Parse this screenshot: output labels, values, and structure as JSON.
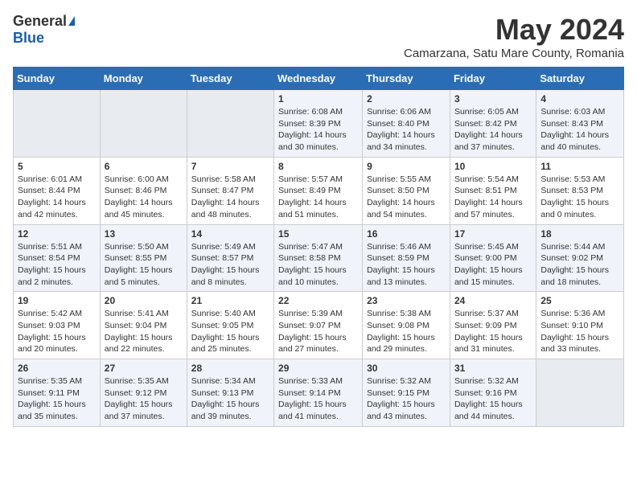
{
  "header": {
    "logo_general": "General",
    "logo_blue": "Blue",
    "month_title": "May 2024",
    "location": "Camarzana, Satu Mare County, Romania"
  },
  "weekdays": [
    "Sunday",
    "Monday",
    "Tuesday",
    "Wednesday",
    "Thursday",
    "Friday",
    "Saturday"
  ],
  "weeks": [
    [
      {
        "day": "",
        "info": ""
      },
      {
        "day": "",
        "info": ""
      },
      {
        "day": "",
        "info": ""
      },
      {
        "day": "1",
        "info": "Sunrise: 6:08 AM\nSunset: 8:39 PM\nDaylight: 14 hours and 30 minutes."
      },
      {
        "day": "2",
        "info": "Sunrise: 6:06 AM\nSunset: 8:40 PM\nDaylight: 14 hours and 34 minutes."
      },
      {
        "day": "3",
        "info": "Sunrise: 6:05 AM\nSunset: 8:42 PM\nDaylight: 14 hours and 37 minutes."
      },
      {
        "day": "4",
        "info": "Sunrise: 6:03 AM\nSunset: 8:43 PM\nDaylight: 14 hours and 40 minutes."
      }
    ],
    [
      {
        "day": "5",
        "info": "Sunrise: 6:01 AM\nSunset: 8:44 PM\nDaylight: 14 hours and 42 minutes."
      },
      {
        "day": "6",
        "info": "Sunrise: 6:00 AM\nSunset: 8:46 PM\nDaylight: 14 hours and 45 minutes."
      },
      {
        "day": "7",
        "info": "Sunrise: 5:58 AM\nSunset: 8:47 PM\nDaylight: 14 hours and 48 minutes."
      },
      {
        "day": "8",
        "info": "Sunrise: 5:57 AM\nSunset: 8:49 PM\nDaylight: 14 hours and 51 minutes."
      },
      {
        "day": "9",
        "info": "Sunrise: 5:55 AM\nSunset: 8:50 PM\nDaylight: 14 hours and 54 minutes."
      },
      {
        "day": "10",
        "info": "Sunrise: 5:54 AM\nSunset: 8:51 PM\nDaylight: 14 hours and 57 minutes."
      },
      {
        "day": "11",
        "info": "Sunrise: 5:53 AM\nSunset: 8:53 PM\nDaylight: 15 hours and 0 minutes."
      }
    ],
    [
      {
        "day": "12",
        "info": "Sunrise: 5:51 AM\nSunset: 8:54 PM\nDaylight: 15 hours and 2 minutes."
      },
      {
        "day": "13",
        "info": "Sunrise: 5:50 AM\nSunset: 8:55 PM\nDaylight: 15 hours and 5 minutes."
      },
      {
        "day": "14",
        "info": "Sunrise: 5:49 AM\nSunset: 8:57 PM\nDaylight: 15 hours and 8 minutes."
      },
      {
        "day": "15",
        "info": "Sunrise: 5:47 AM\nSunset: 8:58 PM\nDaylight: 15 hours and 10 minutes."
      },
      {
        "day": "16",
        "info": "Sunrise: 5:46 AM\nSunset: 8:59 PM\nDaylight: 15 hours and 13 minutes."
      },
      {
        "day": "17",
        "info": "Sunrise: 5:45 AM\nSunset: 9:00 PM\nDaylight: 15 hours and 15 minutes."
      },
      {
        "day": "18",
        "info": "Sunrise: 5:44 AM\nSunset: 9:02 PM\nDaylight: 15 hours and 18 minutes."
      }
    ],
    [
      {
        "day": "19",
        "info": "Sunrise: 5:42 AM\nSunset: 9:03 PM\nDaylight: 15 hours and 20 minutes."
      },
      {
        "day": "20",
        "info": "Sunrise: 5:41 AM\nSunset: 9:04 PM\nDaylight: 15 hours and 22 minutes."
      },
      {
        "day": "21",
        "info": "Sunrise: 5:40 AM\nSunset: 9:05 PM\nDaylight: 15 hours and 25 minutes."
      },
      {
        "day": "22",
        "info": "Sunrise: 5:39 AM\nSunset: 9:07 PM\nDaylight: 15 hours and 27 minutes."
      },
      {
        "day": "23",
        "info": "Sunrise: 5:38 AM\nSunset: 9:08 PM\nDaylight: 15 hours and 29 minutes."
      },
      {
        "day": "24",
        "info": "Sunrise: 5:37 AM\nSunset: 9:09 PM\nDaylight: 15 hours and 31 minutes."
      },
      {
        "day": "25",
        "info": "Sunrise: 5:36 AM\nSunset: 9:10 PM\nDaylight: 15 hours and 33 minutes."
      }
    ],
    [
      {
        "day": "26",
        "info": "Sunrise: 5:35 AM\nSunset: 9:11 PM\nDaylight: 15 hours and 35 minutes."
      },
      {
        "day": "27",
        "info": "Sunrise: 5:35 AM\nSunset: 9:12 PM\nDaylight: 15 hours and 37 minutes."
      },
      {
        "day": "28",
        "info": "Sunrise: 5:34 AM\nSunset: 9:13 PM\nDaylight: 15 hours and 39 minutes."
      },
      {
        "day": "29",
        "info": "Sunrise: 5:33 AM\nSunset: 9:14 PM\nDaylight: 15 hours and 41 minutes."
      },
      {
        "day": "30",
        "info": "Sunrise: 5:32 AM\nSunset: 9:15 PM\nDaylight: 15 hours and 43 minutes."
      },
      {
        "day": "31",
        "info": "Sunrise: 5:32 AM\nSunset: 9:16 PM\nDaylight: 15 hours and 44 minutes."
      },
      {
        "day": "",
        "info": ""
      }
    ]
  ]
}
